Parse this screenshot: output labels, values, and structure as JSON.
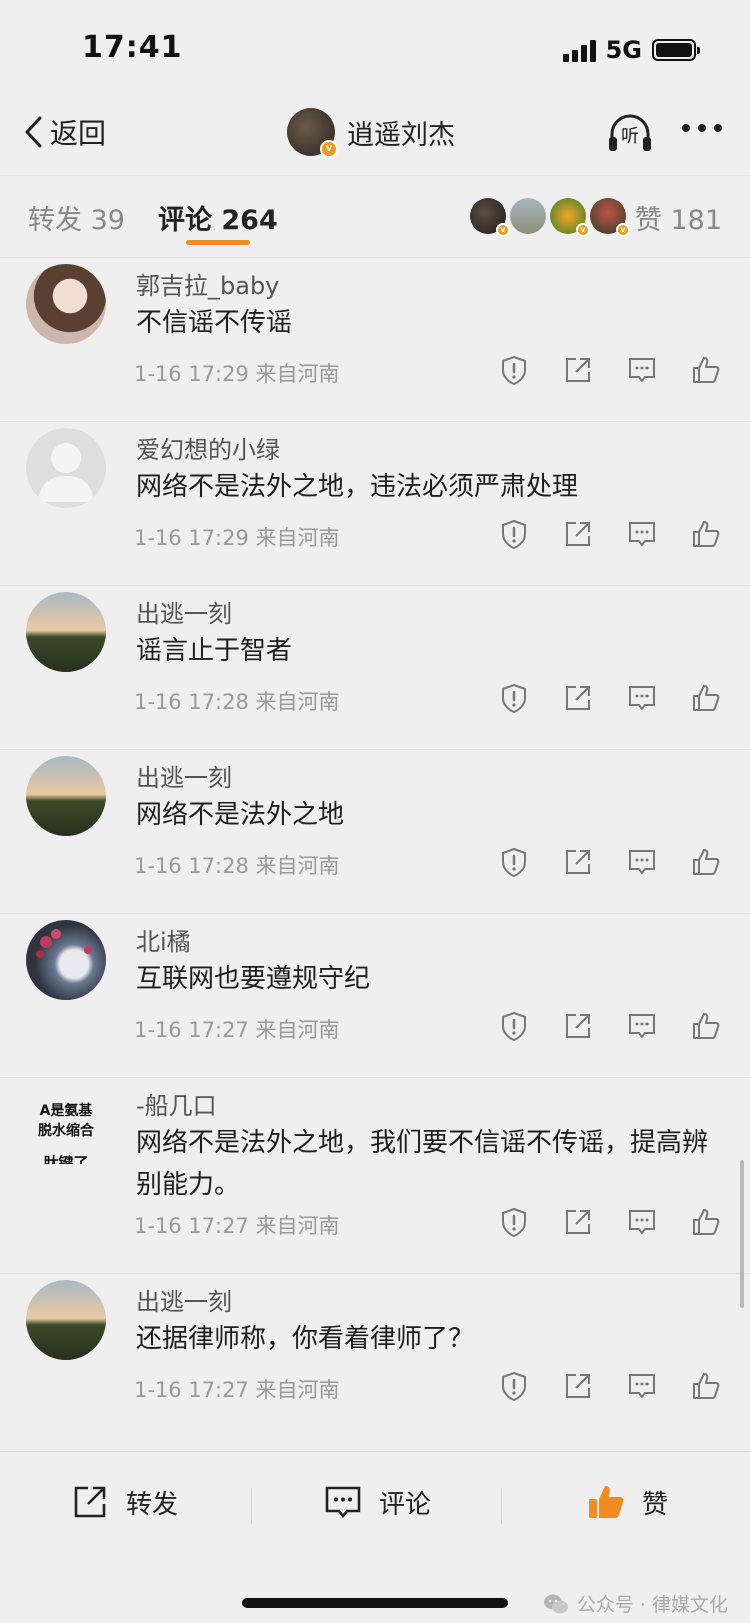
{
  "status_bar": {
    "time": "17:41",
    "network": "5G"
  },
  "nav": {
    "back_label": "返回",
    "title": "逍遥刘杰",
    "listen_label": "听"
  },
  "tabs": {
    "forward_label": "转发 39",
    "comment_label": "评论 264",
    "like_label": "赞 181"
  },
  "comments": [
    {
      "name": "郭吉拉_baby",
      "text": "不信谣不传谣",
      "meta": "1-16 17:29  来自河南",
      "avatar": "portrait"
    },
    {
      "name": "爱幻想的小绿",
      "text": "网络不是法外之地，违法必须严肃处理",
      "meta": "1-16 17:29  来自河南",
      "avatar": "default"
    },
    {
      "name": "出逃一刻",
      "text": "谣言止于智者",
      "meta": "1-16 17:28  来自河南",
      "avatar": "sunset"
    },
    {
      "name": "出逃一刻",
      "text": "网络不是法外之地",
      "meta": "1-16 17:28  来自河南",
      "avatar": "sunset"
    },
    {
      "name": "北i橘",
      "text": "互联网也要遵规守纪",
      "meta": "1-16 17:27  来自河南",
      "avatar": "flowers"
    },
    {
      "name": "-船几口",
      "text": "网络不是法外之地，我们要不信谣不传谣，提高辨别能力。",
      "meta": "1-16 17:27  来自河南",
      "avatar": "text",
      "avatar_text": [
        "A是氨基",
        "脱水缩合",
        "肽键了"
      ]
    },
    {
      "name": "出逃一刻",
      "text": "还据律师称，你看着律师了？",
      "meta": "1-16 17:27  来自河南",
      "avatar": "sunset"
    }
  ],
  "bottom_bar": {
    "forward_label": "转发",
    "comment_label": "评论",
    "like_label": "赞"
  },
  "watermark": "公众号 · 律媒文化",
  "colors": {
    "accent": "#f28c20",
    "background": "#efefef",
    "badge": "#f29a1c"
  }
}
